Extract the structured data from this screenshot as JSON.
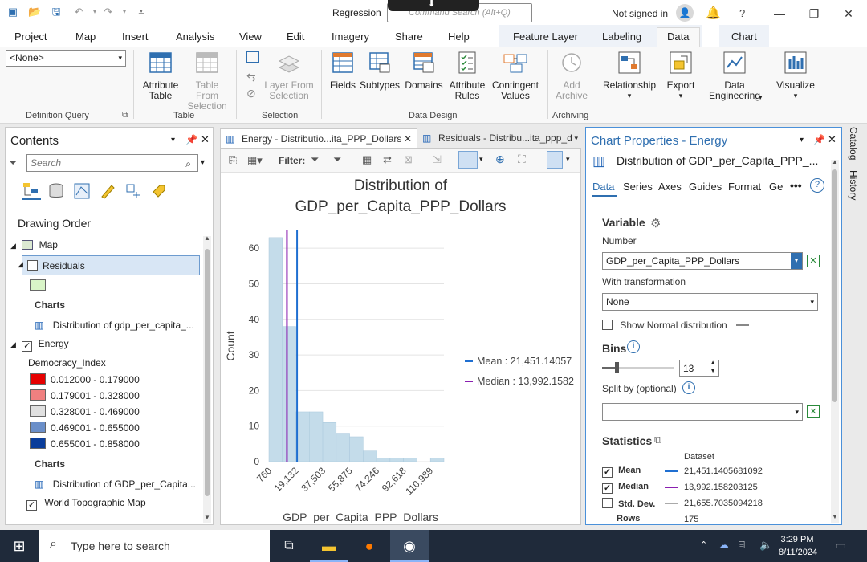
{
  "titlebar": {
    "project_name": "Regression",
    "command_search_placeholder": "Command Search (Alt+Q)",
    "signed_in": "Not signed in",
    "help": "?"
  },
  "ribbon_tabs": {
    "tabs": [
      "Project",
      "Map",
      "Insert",
      "Analysis",
      "View",
      "Edit",
      "Imagery",
      "Share",
      "Help"
    ],
    "contextual": [
      "Feature Layer",
      "Labeling",
      "Data",
      "Chart"
    ],
    "active": "Data"
  },
  "ribbon": {
    "definition_query": {
      "value": "<None>",
      "label": "Definition Query"
    },
    "table_group": {
      "attribute_table": "Attribute Table",
      "table_from_selection": "Table From Selection",
      "label": "Table"
    },
    "selection_group": {
      "layer_from_selection": "Layer From Selection",
      "label": "Selection"
    },
    "data_design_group": {
      "fields": "Fields",
      "subtypes": "Subtypes",
      "domains": "Domains",
      "attribute_rules": "Attribute Rules",
      "contingent_values": "Contingent Values",
      "label": "Data Design"
    },
    "archiving_group": {
      "add_archive": "Add Archive",
      "label": "Archiving"
    },
    "relationship": "Relationship",
    "export": "Export",
    "data_engineering": "Data Engineering",
    "visualize": "Visualize"
  },
  "contents": {
    "title": "Contents",
    "search_placeholder": "Search",
    "drawing_order": "Drawing Order",
    "map": "Map",
    "residuals_layer": "Residuals",
    "charts_label": "Charts",
    "residuals_chart": "Distribution of gdp_per_capita_...",
    "energy_layer": "Energy",
    "democracy_index": "Democracy_Index",
    "legend": [
      {
        "range": "0.012000 - 0.179000",
        "color": "#e60000"
      },
      {
        "range": "0.179001 - 0.328000",
        "color": "#f08080"
      },
      {
        "range": "0.328001 - 0.469000",
        "color": "#e0e0e0"
      },
      {
        "range": "0.469001 - 0.655000",
        "color": "#6b8fc9"
      },
      {
        "range": "0.655001 - 0.858000",
        "color": "#0a3d9a"
      }
    ],
    "charts_label_2": "Charts",
    "energy_chart": "Distribution of GDP_per_Capita...",
    "basemap": "World Topographic Map"
  },
  "chart_tabs": {
    "tab1": "Energy - Distributio...ita_PPP_Dollars",
    "tab2": "Residuals - Distribu...ita_ppp_d",
    "filter_label": "Filter:"
  },
  "chart_data": {
    "type": "bar",
    "title_line1": "Distribution of",
    "title_line2": "GDP_per_Capita_PPP_Dollars",
    "xlabel": "GDP_per_Capita_PPP_Dollars",
    "ylabel": "Count",
    "x_ticks": [
      "760",
      "19,132",
      "37,503",
      "55,875",
      "74,246",
      "92,618",
      "110,989"
    ],
    "y_ticks": [
      0,
      10,
      20,
      30,
      40,
      50,
      60
    ],
    "ylim": [
      0,
      65
    ],
    "xlim": [
      760,
      129361
    ],
    "bin_edges": [
      760,
      10649,
      20538,
      30427,
      40316,
      50205,
      60094,
      69983,
      79872,
      89761,
      99650,
      109539,
      119428,
      129361
    ],
    "values": [
      63,
      38,
      14,
      14,
      11,
      8,
      7,
      3,
      1,
      1,
      1,
      0,
      1
    ],
    "mean": 21451.14057,
    "median": 13992.1582,
    "mean_label": "Mean : 21,451.14057",
    "median_label": "Median : 13,992.1582",
    "bar_color": "#c4dcea",
    "mean_color": "#1f6fd1",
    "median_color": "#8a1fb0"
  },
  "chart_properties": {
    "title": "Chart Properties - Energy",
    "subtitle": "Distribution of GDP_per_Capita_PPP_...",
    "tabs": [
      "Data",
      "Series",
      "Axes",
      "Guides",
      "Format",
      "Ge"
    ],
    "active_tab": "Data",
    "variable_heading": "Variable",
    "number_label": "Number",
    "number_value": "GDP_per_Capita_PPP_Dollars",
    "transformation_label": "With transformation",
    "transformation_value": "None",
    "show_normal": "Show Normal distribution",
    "bins_heading": "Bins",
    "bins_value": "13",
    "bins_slider_fraction": 0.2,
    "split_by_label": "Split by (optional)",
    "split_by_value": "",
    "statistics_heading": "Statistics",
    "dataset_col": "Dataset",
    "stats": [
      {
        "label": "Mean",
        "checked": true,
        "value": "21,451.1405681092",
        "color": "#1f6fd1"
      },
      {
        "label": "Median",
        "checked": true,
        "value": "13,992.158203125",
        "color": "#8a1fb0"
      },
      {
        "label": "Std. Dev.",
        "checked": false,
        "value": "21,655.7035094218",
        "color": "#aaaaaa"
      }
    ],
    "rows_label": "Rows",
    "rows_value": "175"
  },
  "side_tabs": {
    "catalog": "Catalog",
    "history": "History"
  },
  "taskbar": {
    "search_placeholder": "Type here to search",
    "time": "3:29 PM",
    "date": "8/11/2024"
  }
}
